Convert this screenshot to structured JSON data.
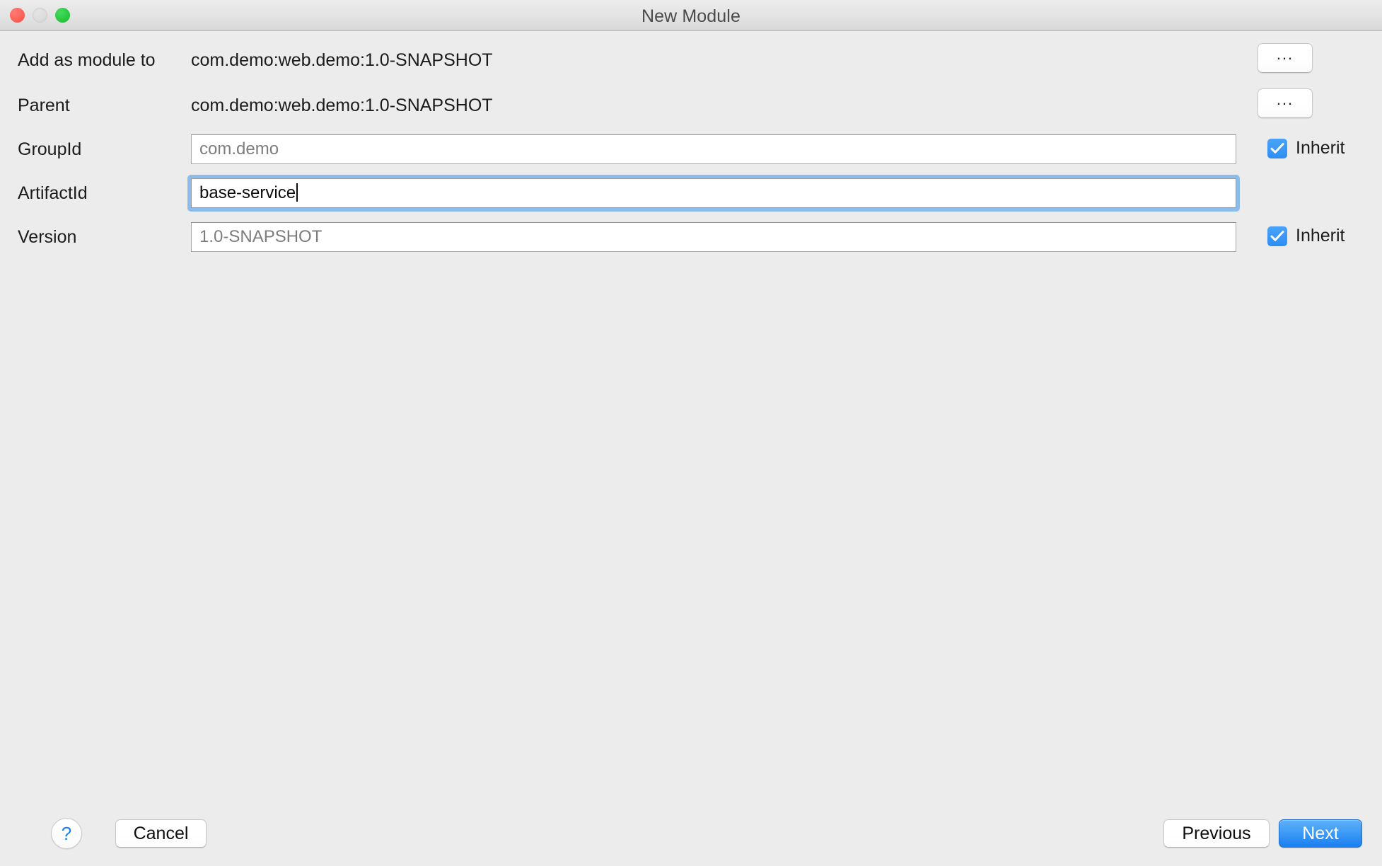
{
  "window": {
    "title": "New Module",
    "traffic_lights": {
      "close": "close-button",
      "minimize": "minimize-button",
      "maximize": "maximize-button"
    }
  },
  "form": {
    "rows": [
      {
        "label": "Add as module to",
        "type": "static",
        "value": "com.demo:web.demo:1.0-SNAPSHOT",
        "browse_label": "...",
        "name": "add-as-module-to"
      },
      {
        "label": "Parent",
        "type": "static",
        "value": "com.demo:web.demo:1.0-SNAPSHOT",
        "browse_label": "...",
        "name": "parent"
      },
      {
        "label": "GroupId",
        "type": "input",
        "value": "com.demo",
        "placeholder": "com.demo",
        "filled": false,
        "focused": false,
        "inherit_label": "Inherit",
        "inherit_checked": true,
        "name": "group-id"
      },
      {
        "label": "ArtifactId",
        "type": "input",
        "value": "base-service",
        "placeholder": "",
        "filled": true,
        "focused": true,
        "inherit_label": "",
        "inherit_checked": false,
        "name": "artifact-id"
      },
      {
        "label": "Version",
        "type": "input",
        "value": "1.0-SNAPSHOT",
        "placeholder": "1.0-SNAPSHOT",
        "filled": false,
        "focused": false,
        "inherit_label": "Inherit",
        "inherit_checked": true,
        "name": "version"
      }
    ]
  },
  "footer": {
    "help_label": "?",
    "cancel_label": "Cancel",
    "previous_label": "Previous",
    "next_label": "Next"
  },
  "colors": {
    "background": "#ececec",
    "accent_blue": "#2e8ef5",
    "default_button": "#1a7ef0",
    "focus_ring": "#8cbcec",
    "placeholder_text": "#7d7d7d",
    "text": "#1b1b1b"
  }
}
